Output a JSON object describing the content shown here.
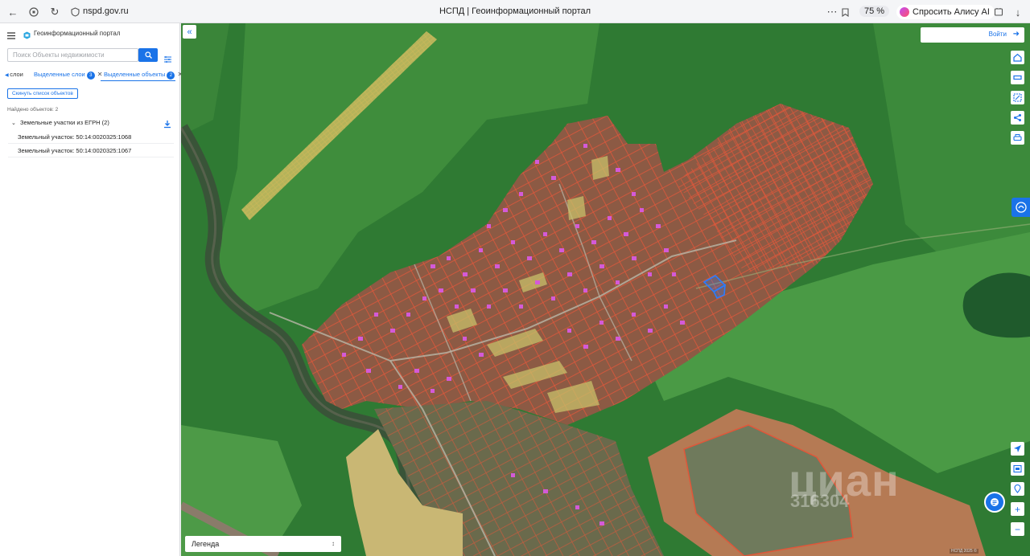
{
  "browser": {
    "url": "nspd.gov.ru",
    "tab_title": "НСПД | Геоинформационный портал",
    "zoom": "75 %",
    "alice_label": "Спросить Алису AI"
  },
  "sidebar": {
    "portal_title": "Геоинформационный портал",
    "search_placeholder": "Поиск Объекты недвижимости",
    "tabs": [
      {
        "label": "слои"
      },
      {
        "label": "Выделенные слои",
        "count": "3"
      },
      {
        "label": "Выделенные объекты",
        "count": "2"
      }
    ],
    "reset_label": "Скинуть список объектов",
    "found_text": "Найдено объектов: 2",
    "group_label": "Земельные участки из ЕГРН (2)",
    "parcels": [
      "Земельный участок: 50:14:0020325:1068",
      "Земельный участок: 50:14:0020325:1067"
    ]
  },
  "map": {
    "login_label": "Войти",
    "legend_label": "Легенда",
    "watermark_text": "циан",
    "watermark_id": "316304",
    "copyright": "НСПД 2025 ©",
    "colors": {
      "forest": "#2f7a33",
      "field": "#4d9a47",
      "village": "#8c5a44",
      "parcel_line": "#e0573a",
      "building": "#d45ad8",
      "selected": "#2a7dff",
      "accent": "#1a73e8"
    }
  }
}
